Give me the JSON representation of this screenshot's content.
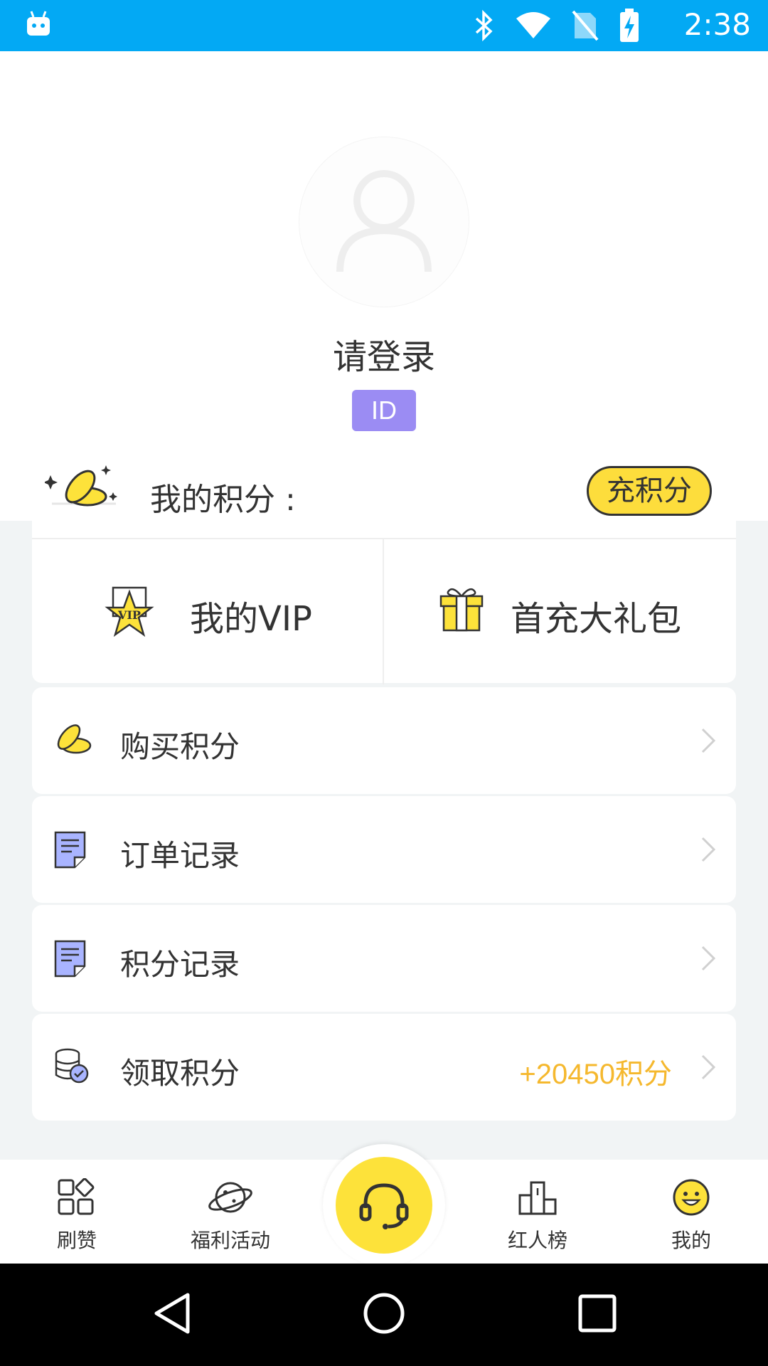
{
  "status_bar": {
    "time": "2:38",
    "color": "#03a9f4",
    "icons": [
      "android-robot-icon",
      "bluetooth-icon",
      "wifi-icon",
      "no-sim-icon",
      "battery-charging-icon"
    ]
  },
  "profile": {
    "login_prompt": "请登录",
    "id_badge": "ID"
  },
  "points": {
    "label": "我的积分 :",
    "recharge_button": "充积分"
  },
  "vip_section": {
    "my_vip": "我的VIP",
    "first_recharge": "首充大礼包"
  },
  "menu": {
    "buy_points": "购买积分",
    "order_records": "订单记录",
    "points_records": "积分记录",
    "claim_points": "领取积分",
    "claim_points_value": "+20450积分"
  },
  "tabs": {
    "likes": "刷赞",
    "welfare": "福利活动",
    "ranking": "红人榜",
    "mine": "我的"
  },
  "colors": {
    "accent_yellow": "#fde23a",
    "id_badge": "#9b8cf3",
    "points_value": "#f5b82e"
  }
}
